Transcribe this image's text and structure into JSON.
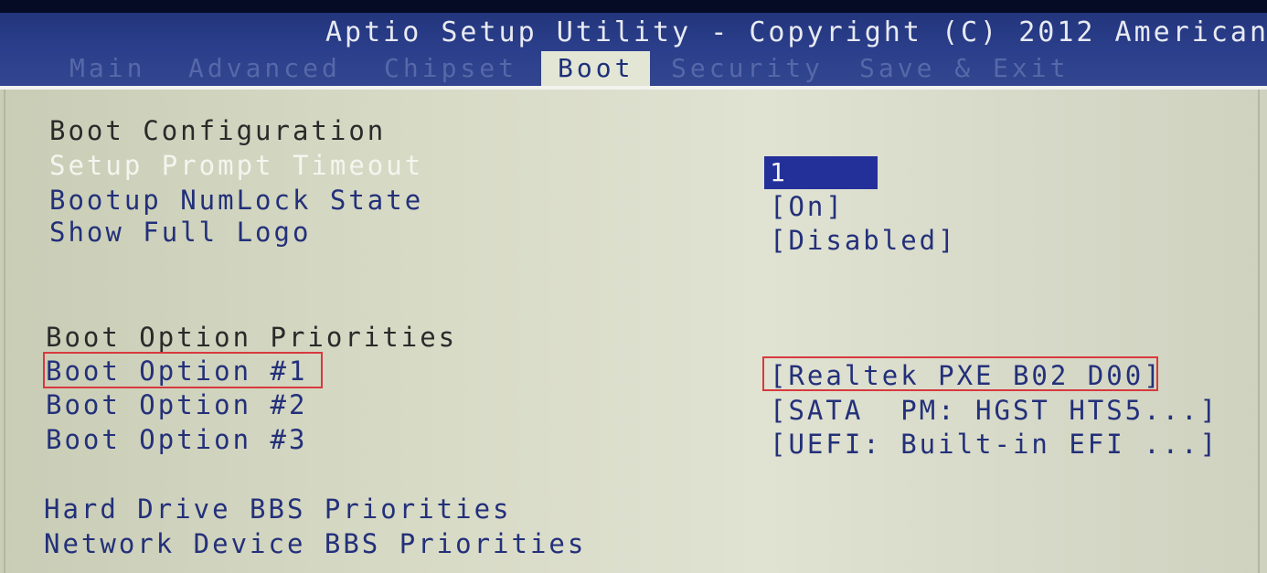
{
  "header": {
    "title": "Aptio Setup Utility - Copyright (C) 2012 American",
    "tabs": [
      {
        "label": "Main"
      },
      {
        "label": "Advanced"
      },
      {
        "label": "Chipset"
      },
      {
        "label": "Boot"
      },
      {
        "label": "Security"
      },
      {
        "label": "Save & Exit"
      }
    ],
    "active_tab": "Boot"
  },
  "boot": {
    "config_heading": "Boot Configuration",
    "settings": [
      {
        "label": "Setup Prompt Timeout",
        "value": "1"
      },
      {
        "label": "Bootup NumLock State",
        "value": "[On]"
      },
      {
        "label": "Show Full Logo",
        "value": "[Disabled]"
      }
    ],
    "priorities_heading": "Boot Option Priorities",
    "options": [
      {
        "label": "Boot Option #1",
        "value": "[Realtek PXE B02 D00]"
      },
      {
        "label": "Boot Option #2",
        "value": "[SATA  PM: HGST HTS5...]"
      },
      {
        "label": "Boot Option #3",
        "value": "[UEFI: Built-in EFI ...]"
      }
    ],
    "submenus": [
      {
        "label": "Hard Drive BBS Priorities"
      },
      {
        "label": "Network Device BBS Priorities"
      }
    ]
  },
  "colors": {
    "header_bg": "#2c3f8c",
    "panel_bg": "#d8dbc6",
    "text_blue": "#23307a",
    "highlight": "#23309a",
    "annotation_red": "#d8393e"
  }
}
